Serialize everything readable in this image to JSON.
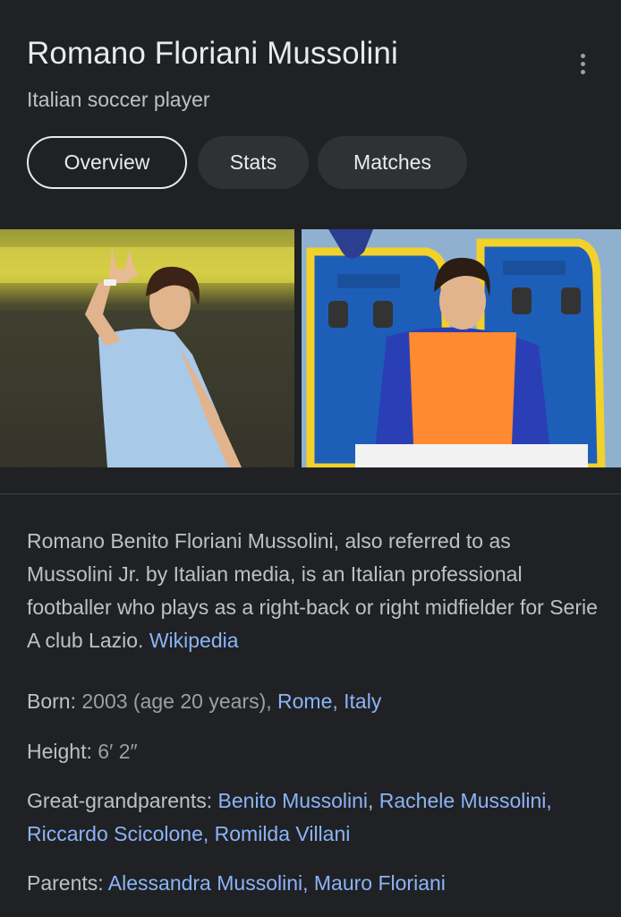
{
  "header": {
    "title": "Romano Floriani Mussolini",
    "subtitle": "Italian soccer player",
    "more_icon": "more-vert-icon"
  },
  "tabs": [
    {
      "label": "Overview",
      "active": true
    },
    {
      "label": "Stats",
      "active": false
    },
    {
      "label": "Matches",
      "active": false
    }
  ],
  "description": {
    "text": "Romano Benito Floriani Mussolini, also referred to as Mussolini Jr. by Italian media, is an Italian professional footballer who plays as a right-back or right midfielder for Serie A club Lazio. ",
    "source_link": "Wikipedia"
  },
  "facts": {
    "born": {
      "label": "Born",
      "value": "2003 (age 20 years), ",
      "link_1": "Rome",
      "sep": ", ",
      "link_2": "Italy"
    },
    "height": {
      "label": "Height",
      "value": "6′ 2″"
    },
    "great_grandparents": {
      "label": "Great-grandparents",
      "links": [
        "Benito Mussolini",
        "Rachele Mussolini",
        "Riccardo Scicolone",
        "Romilda Villani"
      ],
      "sep": ", "
    },
    "parents": {
      "label": "Parents",
      "links": [
        "Alessandra Mussolini",
        "Mauro Floriani"
      ],
      "sep": ", "
    }
  },
  "colors": {
    "background": "#202124",
    "text_primary": "#e8eaed",
    "text_secondary": "#bdc1c6",
    "link": "#8ab4f8"
  }
}
